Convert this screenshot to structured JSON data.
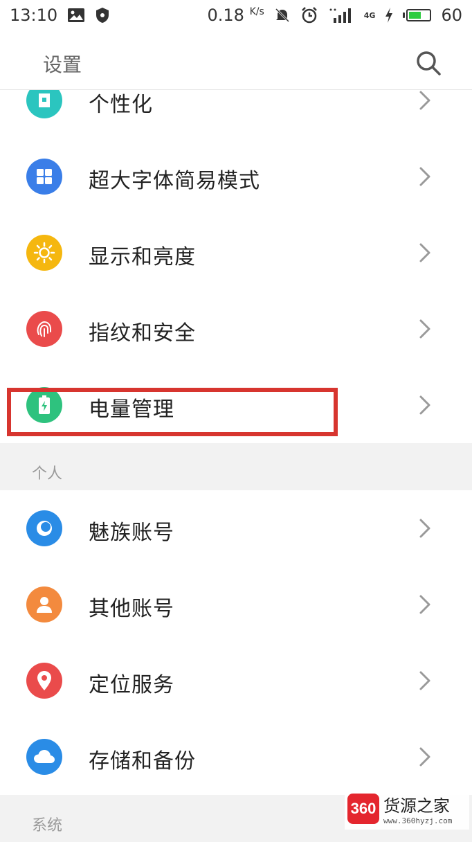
{
  "status_bar": {
    "time": "13:10",
    "net_speed": "0.18",
    "net_unit": "K/s",
    "network_type": "4G",
    "battery_level": 0.6,
    "battery_text": "60"
  },
  "header": {
    "title": "设置",
    "search_icon": "search-icon"
  },
  "sections": [
    {
      "header": "",
      "items": [
        {
          "label": "个性化",
          "icon": "tshirt-icon",
          "color": "#2bc5bf"
        },
        {
          "label": "超大字体简易模式",
          "icon": "grid-icon",
          "color": "#3a7ee8"
        },
        {
          "label": "显示和亮度",
          "icon": "sun-icon",
          "color": "#f5b70f"
        },
        {
          "label": "指纹和安全",
          "icon": "fingerprint-icon",
          "color": "#ea4b4b"
        },
        {
          "label": "电量管理",
          "icon": "battery-icon",
          "color": "#2ec27e"
        }
      ]
    },
    {
      "header": "个人",
      "items": [
        {
          "label": "魅族账号",
          "icon": "meizu-account-icon",
          "color": "#2a8ce6"
        },
        {
          "label": "其他账号",
          "icon": "person-icon",
          "color": "#f38a3e"
        },
        {
          "label": "定位服务",
          "icon": "location-pin-icon",
          "color": "#ea4b4b"
        },
        {
          "label": "存储和备份",
          "icon": "cloud-icon",
          "color": "#2a8ce6"
        }
      ]
    },
    {
      "header": "系统",
      "items": []
    }
  ],
  "watermark": {
    "badge": "360",
    "title": "货源之家",
    "url": "www.360hyzj.com"
  },
  "highlight_color": "#d7352f"
}
